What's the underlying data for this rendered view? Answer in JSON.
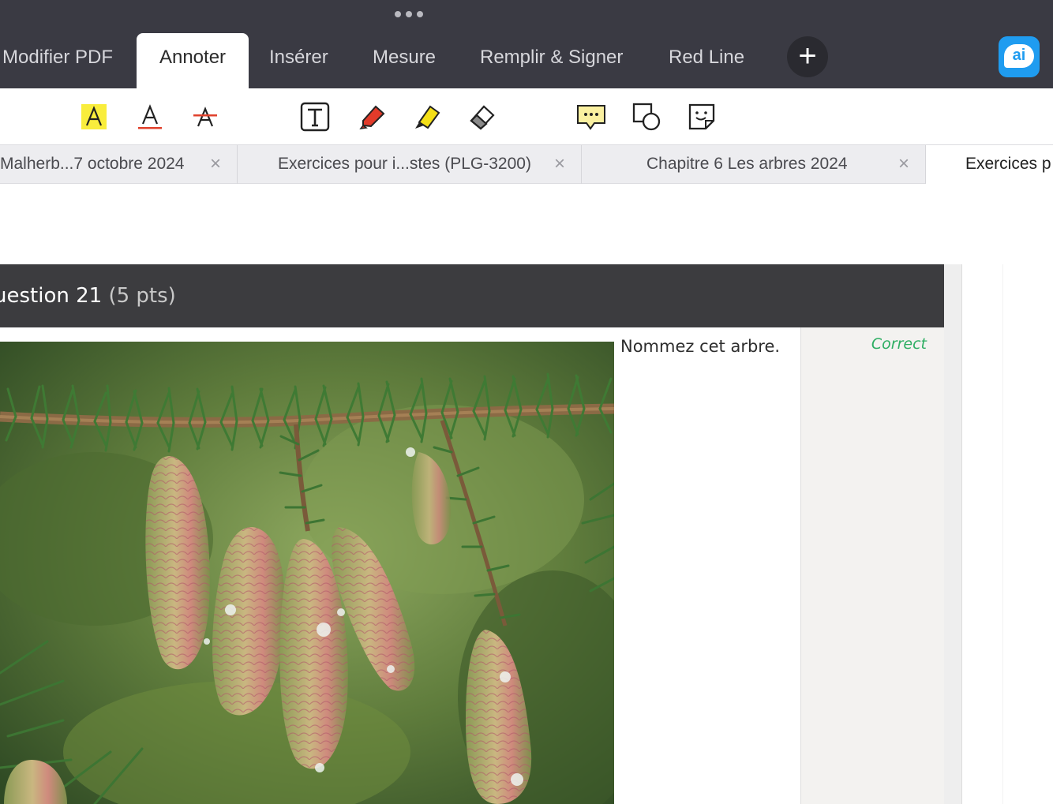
{
  "top_bar": {
    "tabs": [
      {
        "label": "Modifier PDF"
      },
      {
        "label": "Annoter"
      },
      {
        "label": "Insérer"
      },
      {
        "label": "Mesure"
      },
      {
        "label": "Remplir & Signer"
      },
      {
        "label": "Red Line"
      }
    ],
    "active_tab": "Annoter",
    "add_label": "+",
    "ai_label": "ai"
  },
  "toolbar": {
    "tools": [
      {
        "icon": "text-highlight-icon"
      },
      {
        "icon": "text-underline-icon"
      },
      {
        "icon": "text-strikethrough-icon"
      },
      {
        "icon": "text-box-icon"
      },
      {
        "icon": "pen-icon"
      },
      {
        "icon": "highlighter-icon"
      },
      {
        "icon": "eraser-icon"
      },
      {
        "icon": "comment-icon"
      },
      {
        "icon": "shapes-icon"
      },
      {
        "icon": "sticker-icon"
      }
    ],
    "colors": {
      "highlight": "#f9ed3c",
      "markup_red": "#e0412c",
      "pen_red": "#e23b2a",
      "highlighter_yellow": "#f4df17"
    }
  },
  "document_tabs": [
    {
      "title": "Malherb...7 octobre 2024",
      "close": "×"
    },
    {
      "title": "Exercices pour i...stes (PLG-3200)",
      "close": "×"
    },
    {
      "title": "Chapitre 6 Les arbres  2024",
      "close": "×"
    },
    {
      "title": "Exercices p"
    }
  ],
  "question": {
    "title": "uestion 21",
    "points": "(5 pts)",
    "prompt": "Nommez cet arbre.",
    "status": "Correct",
    "status_color": "#2eae63",
    "image_subject": "spruce-branch-with-young-cones"
  }
}
